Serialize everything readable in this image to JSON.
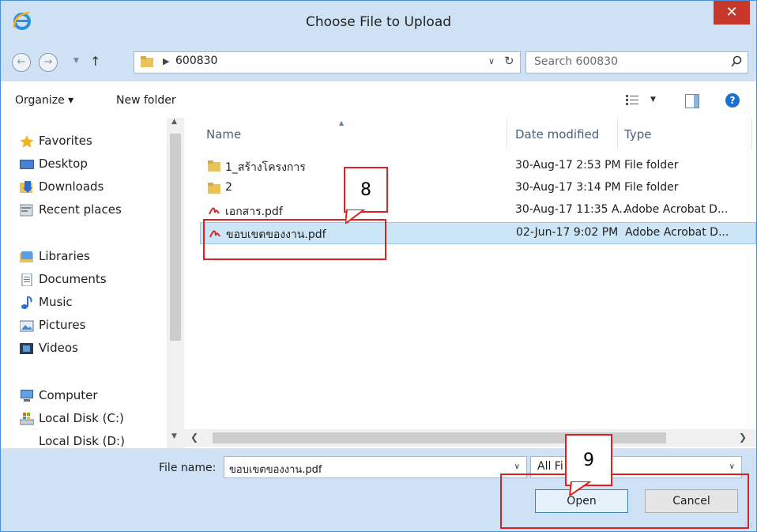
{
  "dialog": {
    "title": "Choose File to Upload",
    "close_label": "✕"
  },
  "address": {
    "path": "600830",
    "search_placeholder": "Search 600830"
  },
  "toolbar": {
    "organize_label": "Organize ▾",
    "new_folder_label": "New folder",
    "help_label": "?"
  },
  "navpane": {
    "favorites": "Favorites",
    "desktop": "Desktop",
    "downloads": "Downloads",
    "recent": "Recent places",
    "libraries": "Libraries",
    "documents": "Documents",
    "music": "Music",
    "pictures": "Pictures",
    "videos": "Videos",
    "computer": "Computer",
    "disk_c": "Local Disk (C:)",
    "disk_d": "Local Disk (D:)"
  },
  "filelist": {
    "columns": {
      "name": "Name",
      "date": "Date modified",
      "type": "Type"
    },
    "rows": [
      {
        "name": "1_สร้างโครงการ",
        "date": "30-Aug-17 2:53 PM",
        "type": "File folder",
        "icon": "folder-icon"
      },
      {
        "name": "2",
        "date": "30-Aug-17 3:14 PM",
        "type": "File folder",
        "icon": "folder-icon"
      },
      {
        "name": "เอกสาร.pdf",
        "date": "30-Aug-17 11:35 A...",
        "type": "Adobe Acrobat D...",
        "icon": "pdf-icon"
      },
      {
        "name": "ขอบเขตของงาน.pdf",
        "date": "02-Jun-17 9:02 PM",
        "type": "Adobe Acrobat D...",
        "icon": "pdf-icon",
        "selected": true
      }
    ]
  },
  "bottom": {
    "filename_label": "File name:",
    "filename_value": "ขอบเขตของงาน.pdf",
    "filetype_value": "All Fi",
    "open_label": "Open",
    "cancel_label": "Cancel"
  },
  "annotations": {
    "step8": "8",
    "step9": "9"
  },
  "colors": {
    "titlebar": "#cfe2f5",
    "close": "#c7372a",
    "selection": "#cde6f7",
    "annotation": "#e02020"
  }
}
